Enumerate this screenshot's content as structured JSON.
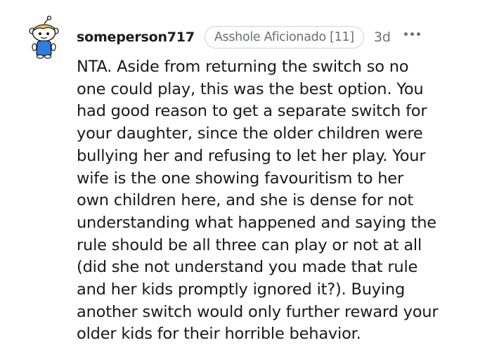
{
  "comment": {
    "author": "someperson717",
    "flair": "Asshole Aficionado [11]",
    "timestamp": "3d",
    "more_icon": "more-horizontal-icon",
    "avatar_icon": "snoo-avatar-icon",
    "body_lines": [
      "NTA. Aside from returning the switch so no",
      "one could play, this was the best option. You",
      "had good reason to get a separate switch for",
      "your daughter, since the older children were",
      "bullying her and refusing to let her play. Your",
      "wife is the one showing favouritism to her",
      "own children here, and she is dense for not",
      "understanding what happened and saying the",
      "rule should be all three can play or not at all",
      "(did she not understand you made that rule",
      "and her kids promptly ignored it?). Buying",
      "another switch would only further reward your",
      "older kids for their horrible behavior."
    ]
  },
  "colors": {
    "text": "#1a1a1b",
    "meta": "#6c6f73",
    "flair_border": "#d0d3d6",
    "avatar_shirt": "#2e7de0",
    "avatar_hair": "#f2cf4a"
  }
}
